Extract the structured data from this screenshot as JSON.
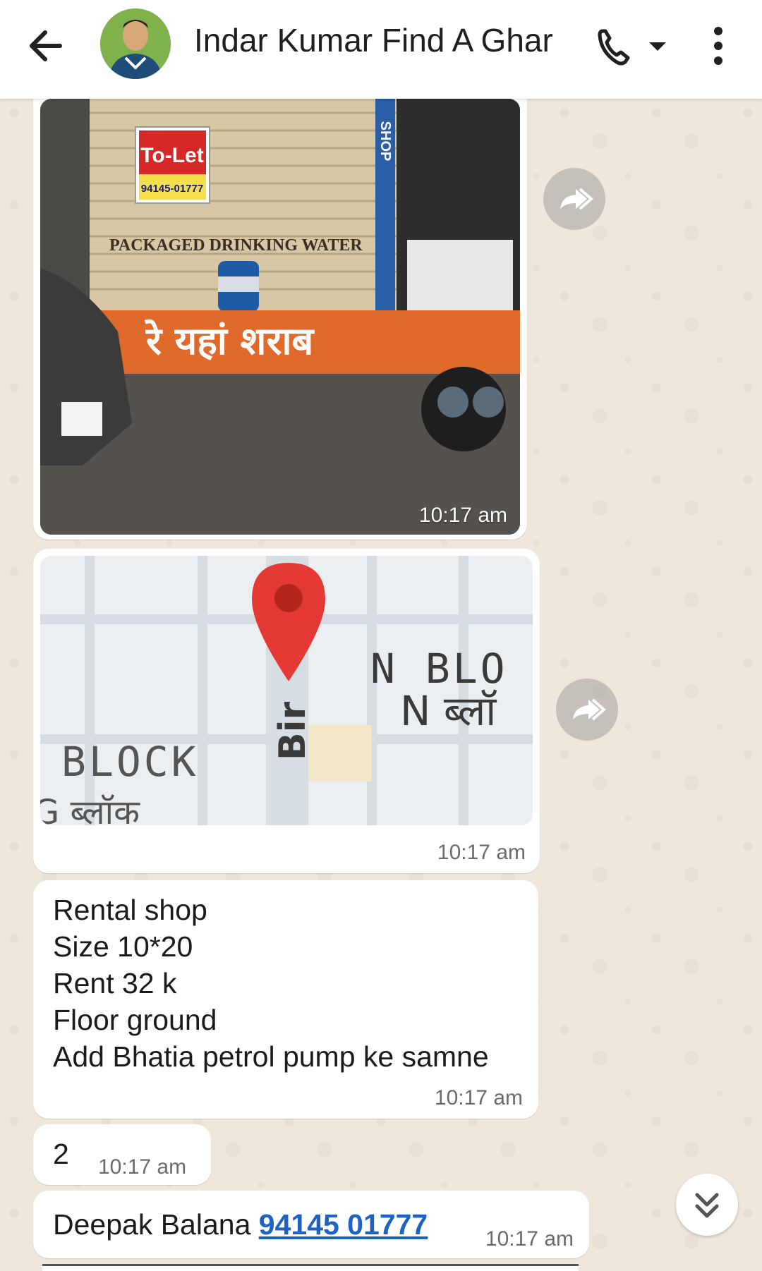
{
  "header": {
    "contact_name": "Indar Kumar Find A Ghar",
    "back_icon": "arrow-left-icon",
    "call_icon": "phone-icon",
    "dropdown_icon": "caret-down-icon",
    "menu_icon": "more-vertical-icon"
  },
  "messages": [
    {
      "type": "image",
      "caption_sign": "To-Let",
      "caption_phone": "94145-01777",
      "shutter_text": "PACKAGED DRINKING WATER",
      "shop_text": "SHOP",
      "hindi_text": "रे यहां शराब",
      "time": "10:17 am"
    },
    {
      "type": "location",
      "map_labels": [
        "N BLO",
        "N ब्लॉ",
        "BLOCK",
        "G ब्लॉक",
        "Bir"
      ],
      "time": "10:17 am"
    },
    {
      "type": "text",
      "lines": "Rental shop\nSize 10*20\nRent 32 k\nFloor ground\nAdd Bhatia petrol pump ke samne",
      "time": "10:17 am"
    },
    {
      "type": "text",
      "lines": "2",
      "time": "10:17 am"
    },
    {
      "type": "contact",
      "name": "Deepak Balana",
      "phone": "94145 01777",
      "time": "10:17 am"
    }
  ],
  "colors": {
    "chat_background": "#efe7dc",
    "bubble": "#ffffff",
    "link": "#1e63c4",
    "pin": "#e53935"
  },
  "scroll_icon": "double-chevron-down-icon"
}
